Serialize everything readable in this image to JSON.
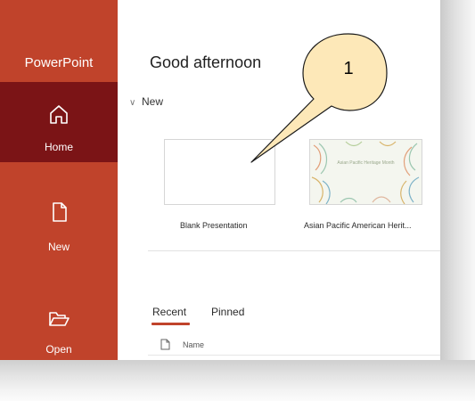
{
  "app": {
    "name": "PowerPoint",
    "accent_color": "#c0432b",
    "active_color": "#7b1416"
  },
  "sidebar": {
    "items": [
      {
        "label": "Home",
        "icon": "home-icon",
        "active": true
      },
      {
        "label": "New",
        "icon": "new-document-icon",
        "active": false
      },
      {
        "label": "Open",
        "icon": "folder-open-icon",
        "active": false
      }
    ]
  },
  "main": {
    "greeting": "Good afternoon",
    "new_section": {
      "label": "New",
      "templates": [
        {
          "caption": "Blank Presentation"
        },
        {
          "caption": "Asian Pacific American Herit...",
          "thumbnail_text": "Asian Pacific Heritage Month"
        }
      ]
    },
    "tabs": [
      {
        "label": "Recent",
        "selected": true
      },
      {
        "label": "Pinned",
        "selected": false
      }
    ],
    "file_list": {
      "name_header": "Name"
    }
  },
  "annotation": {
    "callout_number": "1"
  }
}
